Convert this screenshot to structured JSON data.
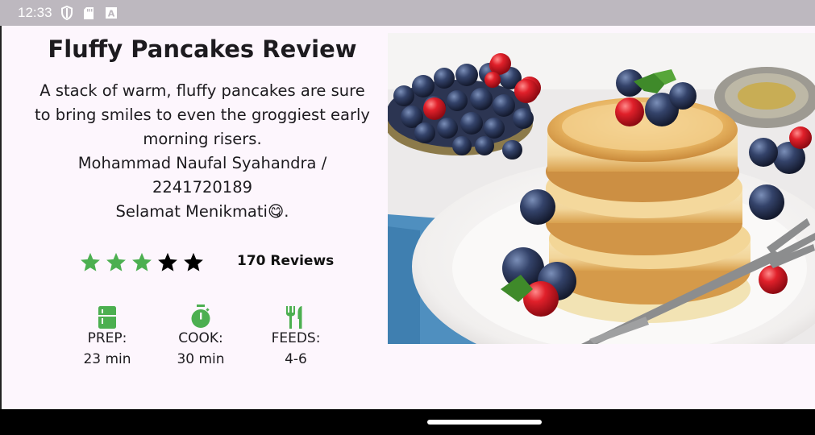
{
  "status": {
    "time": "12:33",
    "icons": [
      "shield-icon",
      "sd-card-icon",
      "font-a-icon"
    ]
  },
  "recipe": {
    "title": "Fluffy Pancakes Review",
    "description_lines": [
      "A stack of warm, fluffy pancakes are sure",
      "to bring smiles to even the groggiest early",
      "morning risers.",
      "Mohammad Naufal Syahandra /",
      "2241720189",
      "Selamat Menikmati😋."
    ],
    "rating": {
      "filled": 3,
      "total": 5,
      "filled_color": "#4caf50",
      "empty_color": "#000000"
    },
    "reviews": "170 Reviews",
    "stats": [
      {
        "icon": "kitchen-icon",
        "label": "PREP:",
        "value": "23 min"
      },
      {
        "icon": "timer-icon",
        "label": "COOK:",
        "value": "30 min"
      },
      {
        "icon": "restaurant-icon",
        "label": "FEEDS:",
        "value": "4-6"
      }
    ],
    "accent": "#4caf50"
  }
}
